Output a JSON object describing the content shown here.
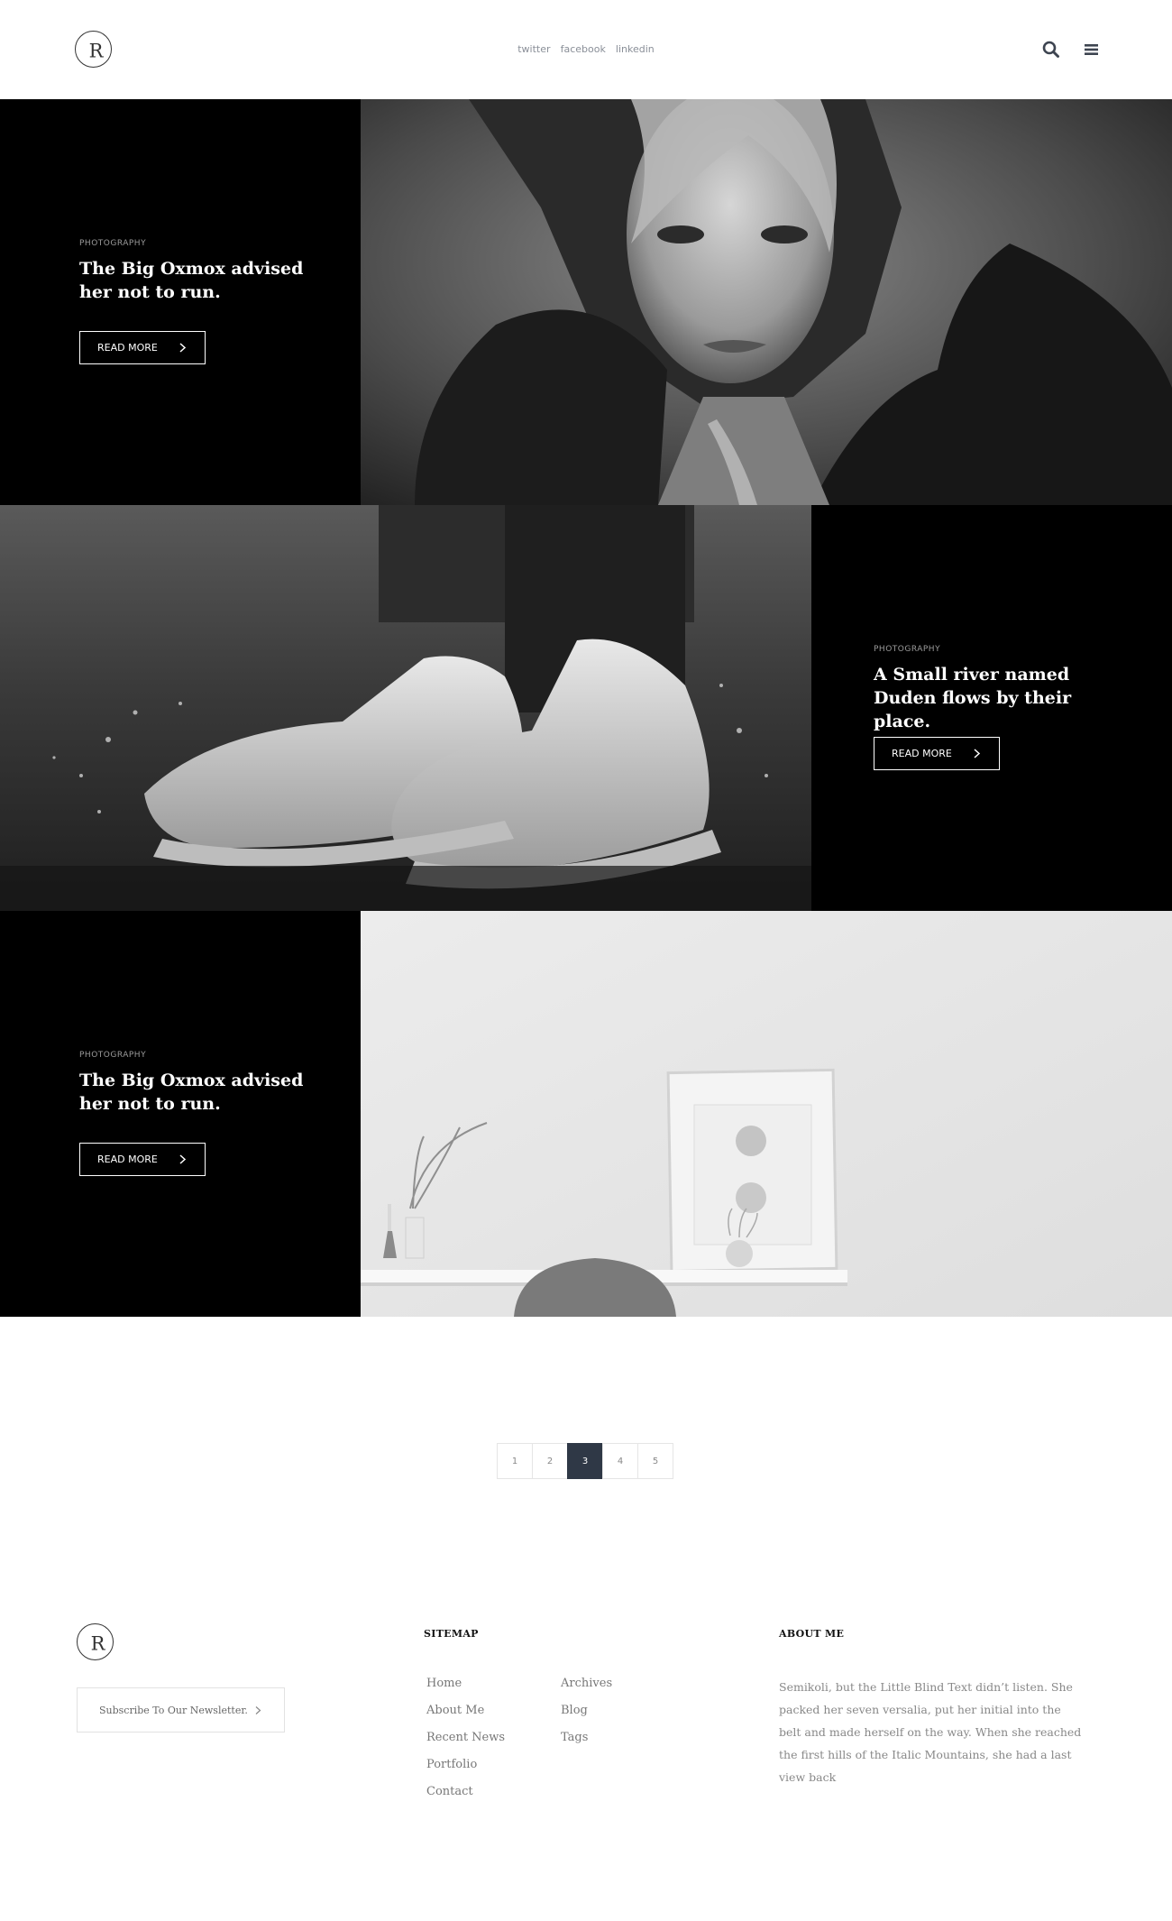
{
  "header": {
    "logo_letter": "R",
    "social": [
      "twitter",
      "facebook",
      "linkedin"
    ],
    "search_icon": "search-icon",
    "menu_icon": "hamburger-menu-icon"
  },
  "posts": [
    {
      "category": "PHOTOGRAPHY",
      "title": "The Big Oxmox advised her not to run.",
      "button": "READ MORE",
      "image": "woman-fur-portrait-bw"
    },
    {
      "category": "PHOTOGRAPHY",
      "title": "A Small river named Duden flows by their place.",
      "button": "READ MORE",
      "image": "sneakers-water-splash-bw"
    },
    {
      "category": "PHOTOGRAPHY",
      "title": "The Big Oxmox advised her not to run.",
      "button": "READ MORE",
      "image": "minimal-desk-interior"
    }
  ],
  "pagination": {
    "pages": [
      "1",
      "2",
      "3",
      "4",
      "5"
    ],
    "current": "3"
  },
  "footer": {
    "logo_letter": "R",
    "newsletter_label": "Subscribe To Our Newsletter.",
    "sitemap_heading": "SITEMAP",
    "sitemap_col1": [
      "Home",
      "About Me",
      "Recent News",
      "Portfolio",
      "Contact"
    ],
    "sitemap_col2": [
      "Archives",
      "Blog",
      "Tags"
    ],
    "about_heading": "ABOUT ME",
    "about_text": "Semikoli, but the Little Blind Text didn’t listen. She packed her seven versalia, put her initial into the belt and made herself on the way. When she reached the first hills of the Italic Mountains, she had a last view back"
  },
  "colors": {
    "accent_dark": "#2f3846",
    "panel": "#000000"
  }
}
